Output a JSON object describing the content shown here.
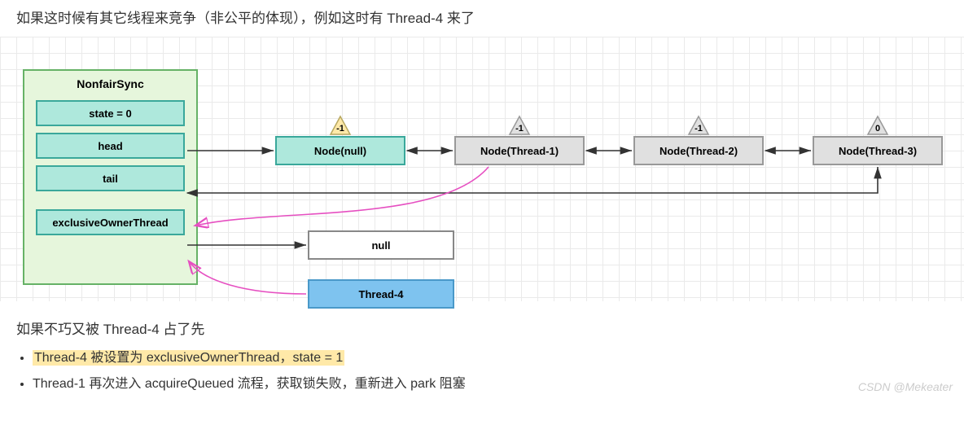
{
  "intro": "如果这时候有其它线程来竞争（非公平的体现），例如这时有 Thread-4 来了",
  "sync": {
    "title": "NonfairSync",
    "fields": {
      "state": "state = 0",
      "head": "head",
      "tail": "tail",
      "owner": "exclusiveOwnerThread"
    }
  },
  "nodes": {
    "n0": {
      "label": "Node(null)",
      "badge": "-1"
    },
    "n1": {
      "label": "Node(Thread-1)",
      "badge": "-1"
    },
    "n2": {
      "label": "Node(Thread-2)",
      "badge": "-1"
    },
    "n3": {
      "label": "Node(Thread-3)",
      "badge": "0"
    },
    "nullNode": {
      "label": "null"
    },
    "t4": {
      "label": "Thread-4"
    }
  },
  "outro": "如果不巧又被 Thread-4 占了先",
  "bullets": {
    "b1": "Thread-4 被设置为 exclusiveOwnerThread，state = 1",
    "b2": "Thread-1 再次进入 acquireQueued 流程，获取锁失败，重新进入 park 阻塞"
  },
  "watermark": "CSDN @Mekeater",
  "chart_data": {
    "type": "diagram",
    "structure": "AQS NonfairSync queue state",
    "sync_object": {
      "name": "NonfairSync",
      "state": 0,
      "head_points_to": "Node(null)",
      "tail_points_to": "Node(Thread-3)",
      "exclusiveOwnerThread_points_to": "null",
      "contender": "Thread-4"
    },
    "queue": [
      {
        "node": "Node(null)",
        "waitStatus": -1
      },
      {
        "node": "Node(Thread-1)",
        "waitStatus": -1
      },
      {
        "node": "Node(Thread-2)",
        "waitStatus": -1
      },
      {
        "node": "Node(Thread-3)",
        "waitStatus": 0
      }
    ],
    "annotations": [
      "head → Node(null)",
      "Node(null) ↔ Node(Thread-1) ↔ Node(Thread-2) ↔ Node(Thread-3)",
      "tail → Node(Thread-3)",
      "exclusiveOwnerThread → null",
      "Thread-4 (magenta) competing → exclusiveOwnerThread",
      "Node(Thread-1) (magenta) attempting → exclusiveOwnerThread"
    ]
  }
}
